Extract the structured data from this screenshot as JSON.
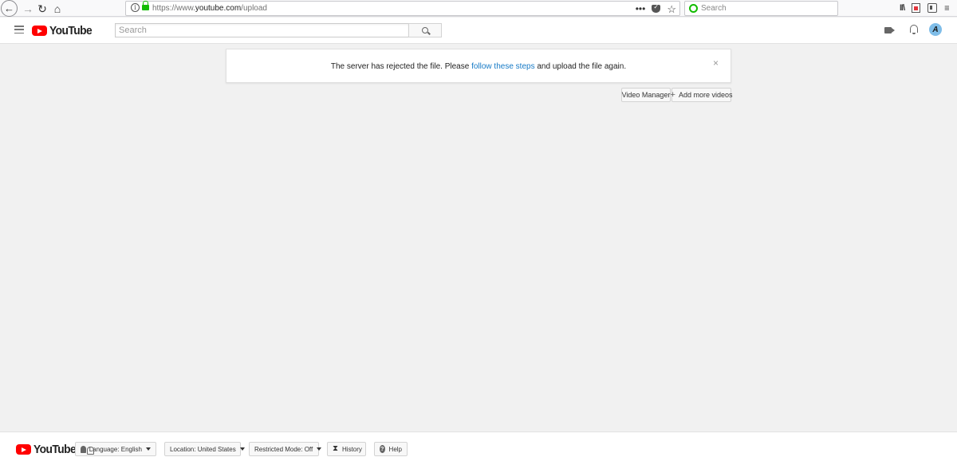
{
  "browser": {
    "url_prefix": "https://www.",
    "url_domain": "youtube.com",
    "url_path": "/upload",
    "url_more": "•••",
    "search_placeholder": "Search"
  },
  "masthead": {
    "logo_text": "YouTube",
    "search_placeholder": "Search",
    "avatar_initial": "A"
  },
  "alert": {
    "text_before": "The server has rejected the file. Please ",
    "link_text": "follow these steps",
    "text_after": " and upload the file again.",
    "close": "×"
  },
  "actions": {
    "video_manager": "Video Manager",
    "add_more": "Add more videos",
    "add_icon": "+"
  },
  "footer": {
    "logo_text": "YouTube",
    "language": "Language: English",
    "location": "Location: United States",
    "restricted": "Restricted Mode: Off",
    "history": "History",
    "help": "Help"
  }
}
